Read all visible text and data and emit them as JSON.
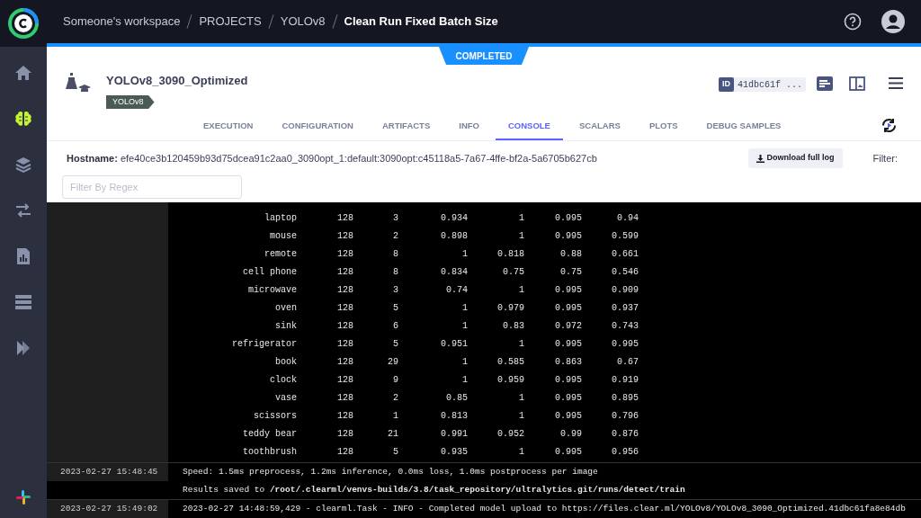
{
  "breadcrumbs": [
    {
      "label": "Someone's workspace",
      "current": false
    },
    {
      "label": "PROJECTS",
      "current": false
    },
    {
      "label": "YOLOv8",
      "current": false
    },
    {
      "label": "Clean Run Fixed Batch Size",
      "current": true
    }
  ],
  "sidebar": {
    "items": [
      {
        "selected": false
      },
      {
        "selected": true
      },
      {
        "selected": false
      },
      {
        "selected": false
      },
      {
        "selected": false
      },
      {
        "selected": false
      },
      {
        "selected": false
      }
    ]
  },
  "status": "COMPLETED",
  "task": {
    "name": "YOLOv8_3090_Optimized",
    "tag": "YOLOv8",
    "id_label": "ID",
    "id": "41dbc61f ..."
  },
  "tabs": [
    {
      "label": "EXECUTION",
      "selected": false
    },
    {
      "label": "CONFIGURATION",
      "selected": false
    },
    {
      "label": "ARTIFACTS",
      "selected": false
    },
    {
      "label": "INFO",
      "selected": false
    },
    {
      "label": "CONSOLE",
      "selected": true
    },
    {
      "label": "SCALARS",
      "selected": false
    },
    {
      "label": "PLOTS",
      "selected": false
    },
    {
      "label": "DEBUG SAMPLES",
      "selected": false
    }
  ],
  "hostname": {
    "label": "Hostname:",
    "value": "efe40ce3b120459b93d75dcea91c2aa0_3090opt_1:default:3090opt:c45118a5-7a67-4ffe-bf2a-5a6705b627cb"
  },
  "download_button": "Download full log",
  "filter_label": "Filter:",
  "filter_field": {
    "placeholder": "Filter By Regex"
  },
  "console": {
    "table_rows": [
      [
        "laptop",
        "128",
        "3",
        "0.934",
        "1",
        "0.995",
        "0.94"
      ],
      [
        "mouse",
        "128",
        "2",
        "0.898",
        "1",
        "0.995",
        "0.599"
      ],
      [
        "remote",
        "128",
        "8",
        "1",
        "0.818",
        "0.88",
        "0.661"
      ],
      [
        "cell phone",
        "128",
        "8",
        "0.834",
        "0.75",
        "0.75",
        "0.546"
      ],
      [
        "microwave",
        "128",
        "3",
        "0.74",
        "1",
        "0.995",
        "0.909"
      ],
      [
        "oven",
        "128",
        "5",
        "1",
        "0.979",
        "0.995",
        "0.937"
      ],
      [
        "sink",
        "128",
        "6",
        "1",
        "0.83",
        "0.972",
        "0.743"
      ],
      [
        "refrigerator",
        "128",
        "5",
        "0.951",
        "1",
        "0.995",
        "0.995"
      ],
      [
        "book",
        "128",
        "29",
        "1",
        "0.585",
        "0.863",
        "0.67"
      ],
      [
        "clock",
        "128",
        "9",
        "1",
        "0.959",
        "0.995",
        "0.919"
      ],
      [
        "vase",
        "128",
        "2",
        "0.85",
        "1",
        "0.995",
        "0.895"
      ],
      [
        "scissors",
        "128",
        "1",
        "0.813",
        "1",
        "0.995",
        "0.796"
      ],
      [
        "teddy bear",
        "128",
        "21",
        "0.991",
        "0.952",
        "0.99",
        "0.876"
      ],
      [
        "toothbrush",
        "128",
        "5",
        "0.935",
        "1",
        "0.995",
        "0.956"
      ]
    ],
    "entries": [
      {
        "timestamp": "2023-02-27 15:48:45",
        "lines": [
          "Speed: 1.5ms preprocess, 1.2ms inference, 0.0ms loss, 1.0ms postprocess per image",
          "Results saved to **/root/.clearml/venvs-builds/3.8/task_repository/ultralytics.git/runs/detect/train**"
        ]
      },
      {
        "timestamp": "2023-02-27 15:49:02",
        "lines": [
          "2023-02-27 14:48:59,429 - clearml.Task - INFO - Completed model upload to https://files.clear.ml/YOLOv8/YOLOv8_3090_Optimized.41dbc61fa8e84db"
        ]
      }
    ]
  }
}
